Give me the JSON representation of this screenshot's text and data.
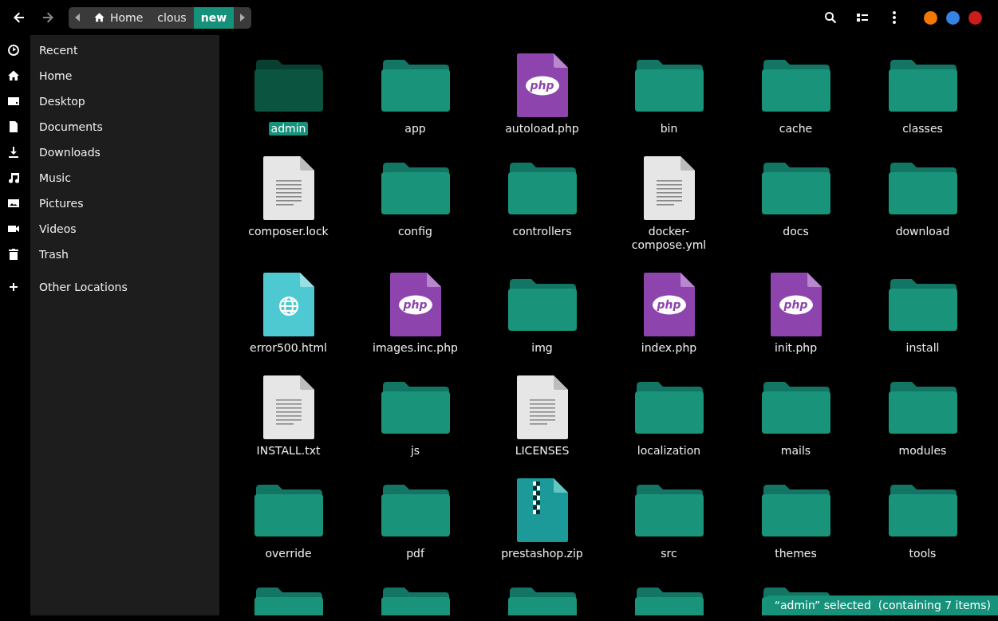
{
  "toolbar": {
    "back_disabled": false,
    "forward_disabled": true,
    "path": [
      {
        "label": "Home",
        "selected": false,
        "home": true
      },
      {
        "label": "clous",
        "selected": false,
        "home": false
      },
      {
        "label": "new",
        "selected": true,
        "home": false
      }
    ],
    "window_buttons": [
      {
        "color": "#f57900"
      },
      {
        "color": "#3584e4"
      },
      {
        "color": "#cc1c1c"
      }
    ]
  },
  "sidebar": {
    "items": [
      {
        "label": "Recent"
      },
      {
        "label": "Home"
      },
      {
        "label": "Desktop"
      },
      {
        "label": "Documents"
      },
      {
        "label": "Downloads"
      },
      {
        "label": "Music"
      },
      {
        "label": "Pictures"
      },
      {
        "label": "Videos"
      },
      {
        "label": "Trash"
      },
      {
        "label": "Other Locations"
      }
    ]
  },
  "files": [
    {
      "name": "admin",
      "kind": "folder",
      "selected": true
    },
    {
      "name": "app",
      "kind": "folder",
      "selected": false
    },
    {
      "name": "autoload.php",
      "kind": "php",
      "icon_text": "php",
      "selected": false
    },
    {
      "name": "bin",
      "kind": "folder",
      "selected": false
    },
    {
      "name": "cache",
      "kind": "folder",
      "selected": false
    },
    {
      "name": "classes",
      "kind": "folder",
      "selected": false
    },
    {
      "name": "composer.lock",
      "kind": "text",
      "selected": false
    },
    {
      "name": "config",
      "kind": "folder",
      "selected": false
    },
    {
      "name": "controllers",
      "kind": "folder",
      "selected": false
    },
    {
      "name": "docker-compose.yml",
      "kind": "text",
      "selected": false
    },
    {
      "name": "docs",
      "kind": "folder",
      "selected": false
    },
    {
      "name": "download",
      "kind": "folder",
      "selected": false
    },
    {
      "name": "error500.html",
      "kind": "html",
      "selected": false
    },
    {
      "name": "images.inc.php",
      "kind": "php",
      "icon_text": "php",
      "selected": false
    },
    {
      "name": "img",
      "kind": "folder",
      "selected": false
    },
    {
      "name": "index.php",
      "kind": "php",
      "icon_text": "php",
      "selected": false
    },
    {
      "name": "init.php",
      "kind": "php",
      "icon_text": "php",
      "selected": false
    },
    {
      "name": "install",
      "kind": "folder",
      "selected": false
    },
    {
      "name": "INSTALL.txt",
      "kind": "text",
      "selected": false
    },
    {
      "name": "js",
      "kind": "folder",
      "selected": false
    },
    {
      "name": "LICENSES",
      "kind": "text",
      "selected": false
    },
    {
      "name": "localization",
      "kind": "folder",
      "selected": false
    },
    {
      "name": "mails",
      "kind": "folder",
      "selected": false
    },
    {
      "name": "modules",
      "kind": "folder",
      "selected": false
    },
    {
      "name": "override",
      "kind": "folder",
      "selected": false
    },
    {
      "name": "pdf",
      "kind": "folder",
      "selected": false
    },
    {
      "name": "prestashop.zip",
      "kind": "zip",
      "selected": false
    },
    {
      "name": "src",
      "kind": "folder",
      "selected": false
    },
    {
      "name": "themes",
      "kind": "folder",
      "selected": false
    },
    {
      "name": "tools",
      "kind": "folder",
      "selected": false
    },
    {
      "kind": "folder",
      "selected": false
    },
    {
      "kind": "folder",
      "selected": false
    },
    {
      "kind": "folder",
      "selected": false
    },
    {
      "kind": "folder",
      "selected": false
    },
    {
      "kind": "folder",
      "selected": false
    }
  ],
  "status_bar": "“admin” selected  (containing 7 items)"
}
